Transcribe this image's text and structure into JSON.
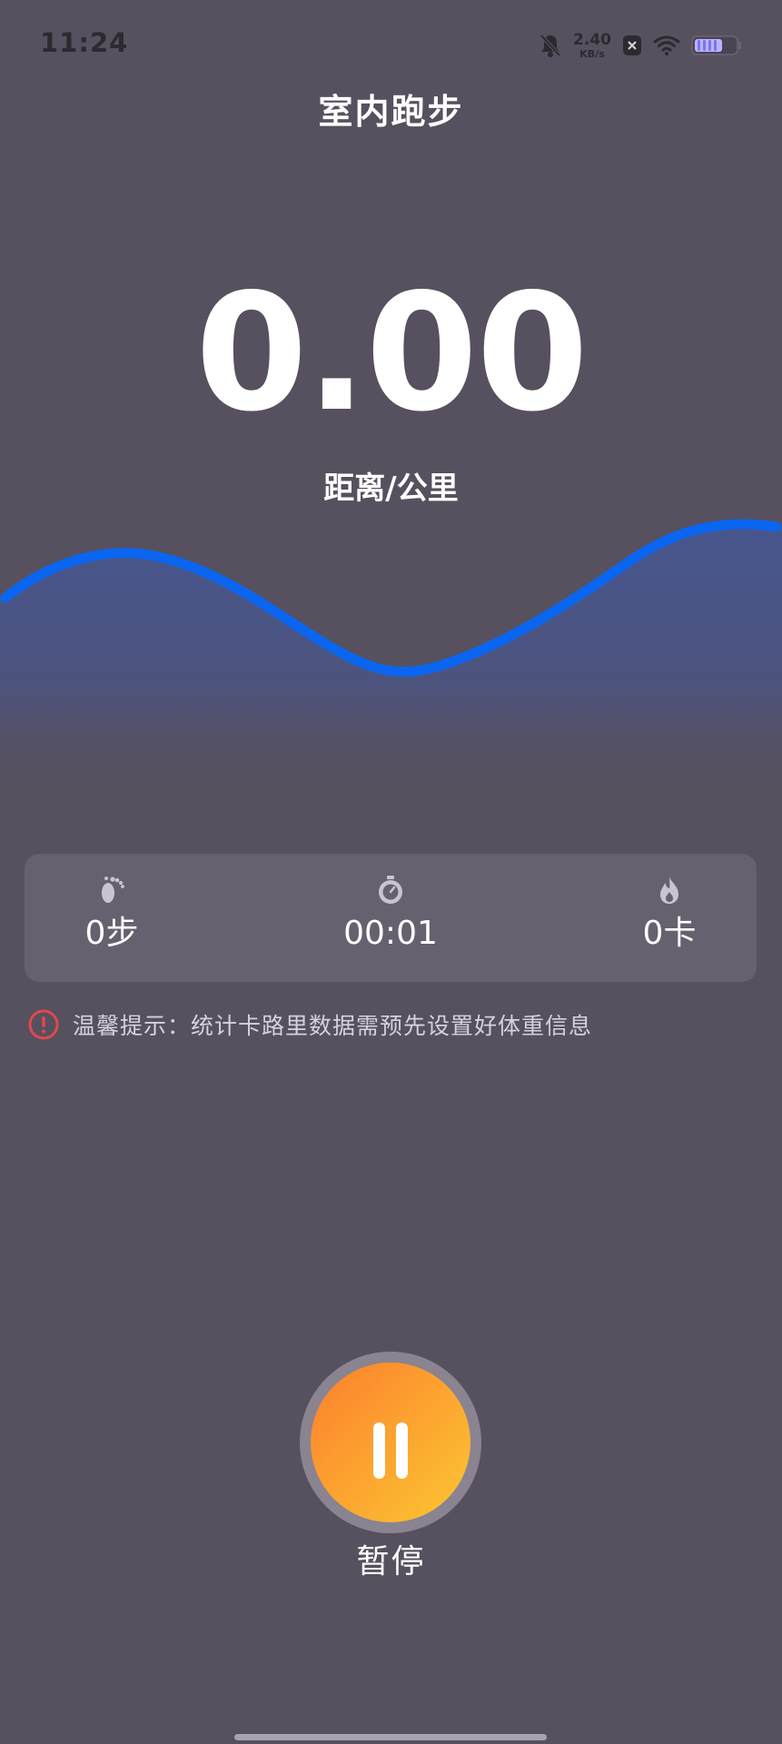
{
  "status_bar": {
    "time": "11:24",
    "net_speed_value": "2.40",
    "net_speed_unit": "KB/s",
    "icons": [
      "bell-muted-icon",
      "close-box-icon",
      "wifi-icon",
      "battery-icon"
    ]
  },
  "header": {
    "title": "室内跑步"
  },
  "distance": {
    "value": "0.00",
    "label": "距离/公里"
  },
  "stats": [
    {
      "icon": "footprints-icon",
      "value": "0步"
    },
    {
      "icon": "stopwatch-icon",
      "value": "00:01"
    },
    {
      "icon": "flame-icon",
      "value": "0卡"
    }
  ],
  "tip": {
    "icon": "warning-circle-icon",
    "text": "温馨提示：统计卡路里数据需预先设置好体重信息"
  },
  "control": {
    "pause_label": "暂停"
  },
  "colors": {
    "background": "#57505e",
    "wave_line": "#0a66f0",
    "card": "#67606e",
    "pause_gradient_start": "#fb7f2e",
    "pause_gradient_end": "#fcc632",
    "tip_icon": "#e0484f"
  }
}
